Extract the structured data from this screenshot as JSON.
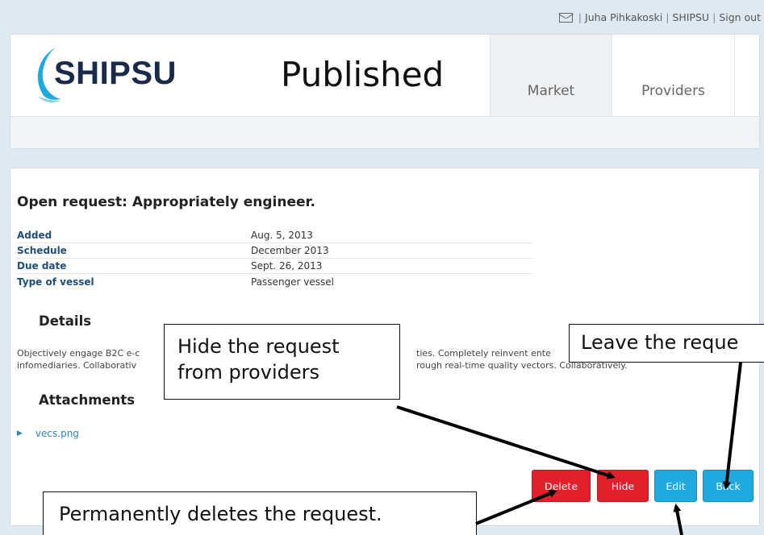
{
  "topbar": {
    "user_name": "Juha Pihkakoski",
    "company": "SHIPSU",
    "sign_out": "Sign out",
    "separator": "|"
  },
  "header": {
    "logo_text": "SHIPSU",
    "status": "Published",
    "nav": [
      {
        "label": "Market"
      },
      {
        "label": "Providers"
      }
    ]
  },
  "request": {
    "title": "Open request: Appropriately engineer.",
    "fields": [
      {
        "label": "Added",
        "value": "Aug. 5, 2013"
      },
      {
        "label": "Schedule",
        "value": "December 2013"
      },
      {
        "label": "Due date",
        "value": "Sept. 26, 2013"
      },
      {
        "label": "Type of vessel",
        "value": "Passenger vessel"
      }
    ],
    "details_heading": "Details",
    "details_line1": "Objectively engage B2C e-c",
    "details_line1_end": "ties. Completely reinvent ente",
    "details_line2": "infomediaries. Collaborativ",
    "details_line2_end": "rough real-time quality vectors. Collaboratively.",
    "attachments_heading": "Attachments",
    "attachments": [
      {
        "name": "vecs.png"
      }
    ]
  },
  "actions": {
    "delete": "Delete",
    "hide": "Hide",
    "edit": "Edit",
    "back": "Back"
  },
  "callouts": {
    "hide_line1": "Hide the request",
    "hide_line2": "from providers",
    "leave": "Leave the reque",
    "delete": "Permanently deletes the request."
  },
  "colors": {
    "red_button": "#e2202b",
    "blue_button": "#1ea9df",
    "label_blue": "#1f4e7a",
    "link_blue": "#2a86c4",
    "logo_blue": "#1ea9df"
  },
  "icons": {
    "mail": "mail-icon",
    "attachment_bullet": "triangle-bullet-icon"
  }
}
